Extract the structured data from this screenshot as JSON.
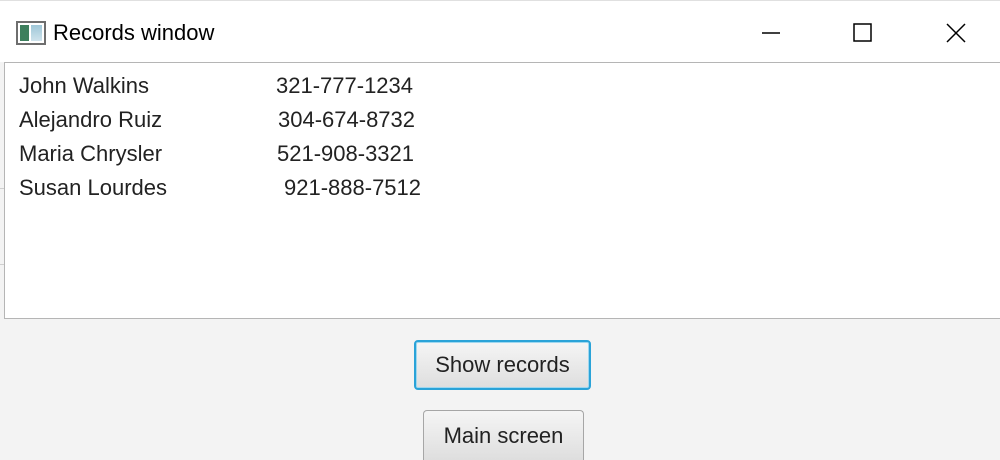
{
  "window": {
    "title": "Records window",
    "controls": {
      "minimize": "minimize-icon",
      "maximize": "maximize-icon",
      "close": "close-icon"
    }
  },
  "records": [
    {
      "name": "John Walkins",
      "phone": "321-777-1234"
    },
    {
      "name": "Alejandro Ruiz",
      "phone": "304-674-8732"
    },
    {
      "name": "Maria Chrysler",
      "phone": "521-908-3321"
    },
    {
      "name": "Susan Lourdes",
      "phone": "921-888-7512"
    }
  ],
  "buttons": {
    "show_records": "Show records",
    "main_screen": "Main screen"
  },
  "colors": {
    "focus_ring": "#2aa3d8",
    "titlebar": "#ffffff",
    "background": "#f3f3f3"
  }
}
